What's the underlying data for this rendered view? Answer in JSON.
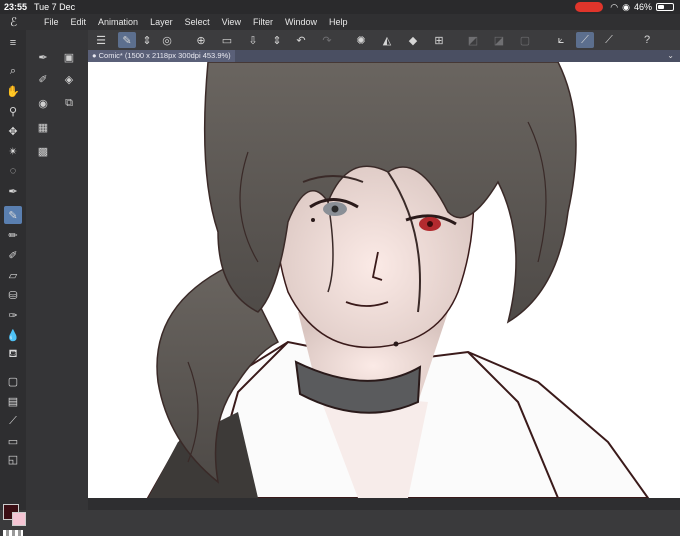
{
  "status_bar": {
    "time": "23:55",
    "date": "Tue 7 Dec",
    "battery": "46%"
  },
  "menu": {
    "items": [
      "File",
      "Edit",
      "Animation",
      "Layer",
      "Select",
      "View",
      "Filter",
      "Window",
      "Help"
    ]
  },
  "tools": {
    "selected": "pen-tool"
  },
  "colors": {
    "main": "#3b0e14",
    "sub": "#f5c5d4"
  },
  "document": {
    "tab_label": "Comic* (1500 x 2118px 300dpi 453.9%)"
  }
}
